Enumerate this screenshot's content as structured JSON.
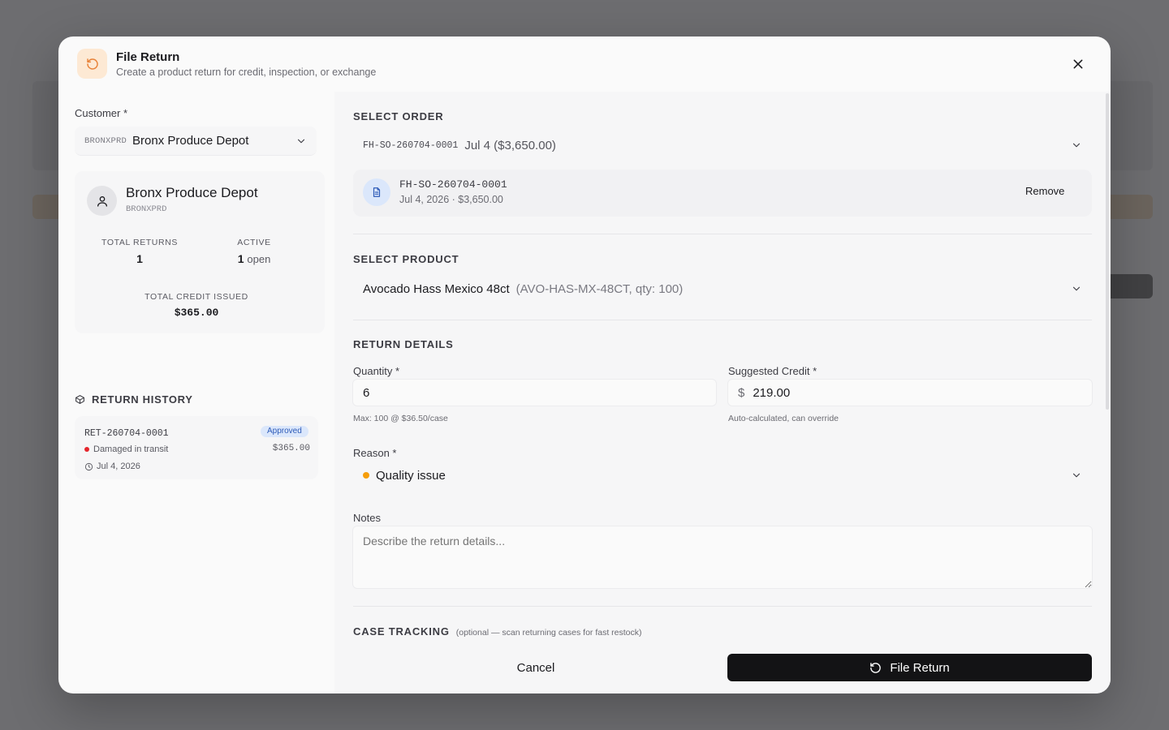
{
  "header": {
    "title": "File Return",
    "subtitle": "Create a product return for credit, inspection, or exchange",
    "icon": "rotate-ccw-icon",
    "close_icon": "close-icon"
  },
  "customer": {
    "label": "Customer *",
    "selected_code": "BRONXPRD",
    "selected_name": "Bronx Produce Depot"
  },
  "customer_card": {
    "name": "Bronx Produce Depot",
    "code": "BRONXPRD",
    "total_returns_label": "TOTAL RETURNS",
    "total_returns_value": "1",
    "active_label": "ACTIVE",
    "active_value": "1",
    "active_unit": "open",
    "credit_label": "TOTAL CREDIT ISSUED",
    "credit_value": "$365.00"
  },
  "history": {
    "title": "RETURN HISTORY",
    "items": [
      {
        "id": "RET-260704-0001",
        "status": "Approved",
        "reason": "Damaged in transit",
        "amount": "$365.00",
        "date": "Jul 4, 2026"
      }
    ]
  },
  "order": {
    "section_title": "SELECT ORDER",
    "selected_code": "FH-SO-260704-0001",
    "selected_text": "Jul 4 ($3,650.00)",
    "card_code": "FH-SO-260704-0001",
    "card_meta": "Jul 4, 2026 · $3,650.00",
    "remove_label": "Remove"
  },
  "product": {
    "section_title": "SELECT PRODUCT",
    "selected_name": "Avocado Hass Mexico 48ct",
    "selected_detail": "(AVO-HAS-MX-48CT, qty: 100)"
  },
  "details": {
    "section_title": "RETURN DETAILS",
    "quantity_label": "Quantity *",
    "quantity_value": "6",
    "quantity_hint": "Max: 100 @ $36.50/case",
    "credit_label": "Suggested Credit *",
    "credit_prefix": "$",
    "credit_value": "219.00",
    "credit_hint": "Auto-calculated, can override",
    "reason_label": "Reason *",
    "reason_value": "Quality issue",
    "notes_label": "Notes",
    "notes_placeholder": "Describe the return details..."
  },
  "case_tracking": {
    "title": "CASE TRACKING",
    "subtitle": "(optional — scan returning cases for fast restock)"
  },
  "footer": {
    "cancel_label": "Cancel",
    "submit_label": "File Return"
  },
  "colors": {
    "accent_dark": "#131315",
    "header_icon_bg": "#fde9d4",
    "header_icon": "#e8833a",
    "badge_bg": "#dbe7fb",
    "badge_text": "#2e5bb8",
    "reason_dot": "#f59e0b",
    "history_dot": "#e5252c"
  }
}
